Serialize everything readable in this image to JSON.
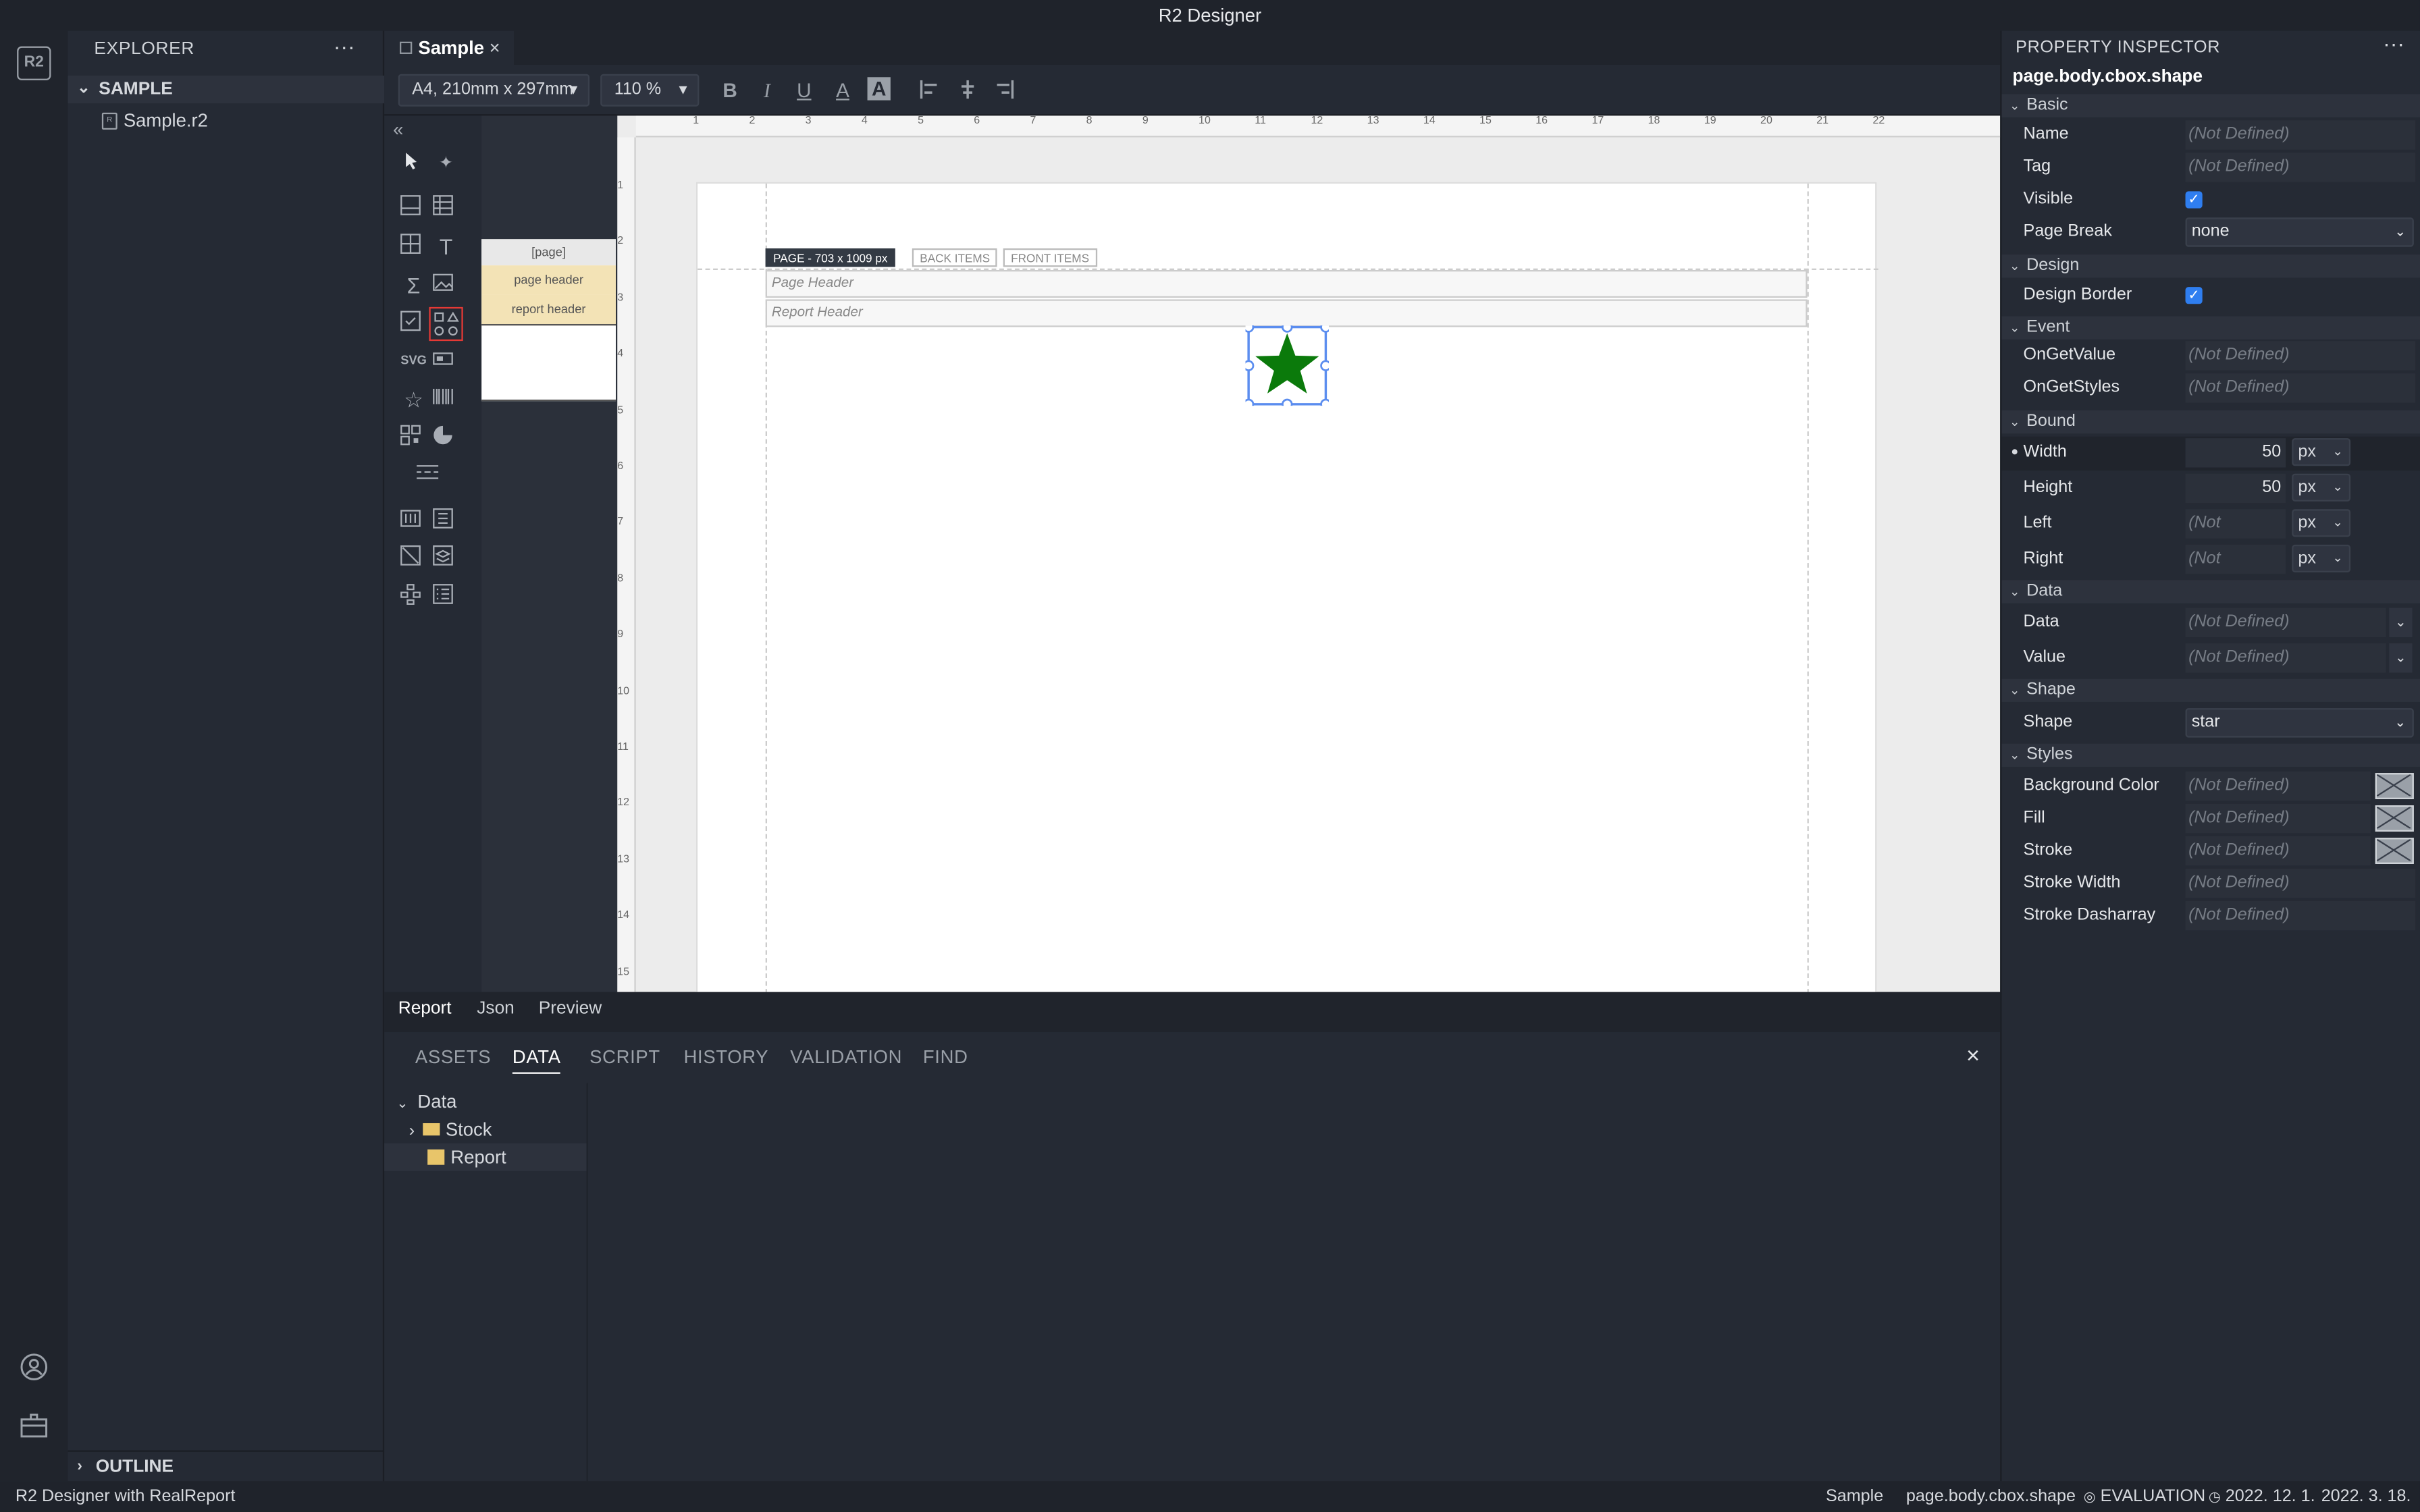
{
  "app": {
    "title": "R2 Designer"
  },
  "explorer": {
    "title": "EXPLORER",
    "more": "···",
    "section": "SAMPLE",
    "file": "Sample.r2",
    "outline": "OUTLINE"
  },
  "editor": {
    "tab": "Sample",
    "tab_close": "×",
    "paper_size": "A4, 210mm x 297mm",
    "zoom": "110 %"
  },
  "bands": {
    "page": "[page]",
    "page_header": "page header",
    "report_header": "report header"
  },
  "canvas": {
    "page_tag": "PAGE - 703 x 1009 px",
    "back_items": "BACK ITEMS",
    "front_items": "FRONT ITEMS",
    "page_header": "Page Header",
    "report_header": "Report Header",
    "shape_fill": "#0b7a0b",
    "ruler_h": [
      "1",
      "2",
      "3",
      "4",
      "5",
      "6",
      "7",
      "8",
      "9",
      "10",
      "11",
      "12",
      "13",
      "14",
      "15",
      "16",
      "17",
      "18",
      "19",
      "20",
      "21",
      "22"
    ],
    "ruler_v": [
      "1",
      "2",
      "3",
      "4",
      "5",
      "6",
      "7",
      "8",
      "9",
      "10",
      "11",
      "12",
      "13",
      "14",
      "15"
    ]
  },
  "view_tabs": [
    "Report",
    "Json",
    "Preview"
  ],
  "data_panel": {
    "tabs": [
      "ASSETS",
      "DATA",
      "SCRIPT",
      "HISTORY",
      "VALIDATION",
      "FIND"
    ],
    "active": "DATA",
    "close": "×",
    "tree": {
      "root": "Data",
      "items": [
        "Stock",
        "Report"
      ]
    }
  },
  "inspector": {
    "title": "PROPERTY INSPECTOR",
    "more": "···",
    "path": "page.body.cbox.shape",
    "not_defined": "(Not Defined)",
    "groups": {
      "basic": "Basic",
      "design": "Design",
      "event": "Event",
      "bound": "Bound",
      "data": "Data",
      "shape": "Shape",
      "styles": "Styles"
    },
    "labels": {
      "name": "Name",
      "tag": "Tag",
      "visible": "Visible",
      "page_break": "Page Break",
      "design_border": "Design Border",
      "on_get_value": "OnGetValue",
      "on_get_styles": "OnGetStyles",
      "width": "Width",
      "height": "Height",
      "left": "Left",
      "right": "Right",
      "data": "Data",
      "value": "Value",
      "shape": "Shape",
      "background_color": "Background Color",
      "fill": "Fill",
      "stroke": "Stroke",
      "stroke_width": "Stroke Width",
      "stroke_dasharray": "Stroke Dasharray"
    },
    "values": {
      "page_break": "none",
      "width": "50",
      "height": "50",
      "unit": "px",
      "shape": "star"
    }
  },
  "status": {
    "left": "R2 Designer with RealReport",
    "doc": "Sample",
    "path": "page.body.cbox.shape",
    "mode": "EVALUATION",
    "date1": "2022. 12. 1.",
    "date2": "2022. 3. 18."
  }
}
